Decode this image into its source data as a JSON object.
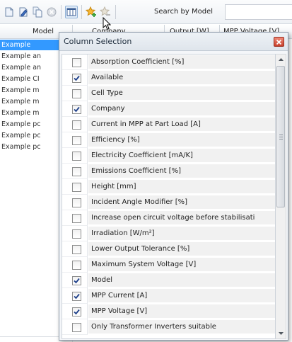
{
  "toolbar": {
    "search_label": "Search by Model",
    "search_value": "",
    "icons": [
      "new-icon",
      "edit-icon",
      "copy-icon",
      "delete-icon",
      "column-selection-icon",
      "add-favorite-icon",
      "remove-favorite-icon"
    ]
  },
  "table": {
    "columns": [
      "Model",
      "Company",
      "Output [W]",
      "MPP Voltage [V]"
    ],
    "rows": [
      "Example",
      "Example an",
      "Example an",
      "Example CI",
      "Example m",
      "Example m",
      "Example m",
      "Example pc",
      "Example pc",
      "Example pc"
    ]
  },
  "dialog": {
    "title": "Column Selection",
    "items": [
      {
        "label": "Absorption Coefficient [%]",
        "checked": false
      },
      {
        "label": "Available",
        "checked": true
      },
      {
        "label": "Cell Type",
        "checked": false
      },
      {
        "label": "Company",
        "checked": true
      },
      {
        "label": "Current in MPP at Part Load [A]",
        "checked": false
      },
      {
        "label": "Efficiency [%]",
        "checked": false
      },
      {
        "label": "Electricity Coefficient [mA/K]",
        "checked": false
      },
      {
        "label": "Emissions Coefficient [%]",
        "checked": false
      },
      {
        "label": "Height [mm]",
        "checked": false
      },
      {
        "label": "Incident Angle Modifier [%]",
        "checked": false
      },
      {
        "label": "Increase open circuit voltage before stabilisati",
        "checked": false
      },
      {
        "label": "Irradiation [W/m²]",
        "checked": false
      },
      {
        "label": "Lower Output Tolerance [%]",
        "checked": false
      },
      {
        "label": "Maximum System Voltage [V]",
        "checked": false
      },
      {
        "label": "Model",
        "checked": true
      },
      {
        "label": "MPP Current [A]",
        "checked": true
      },
      {
        "label": "MPP Voltage [V]",
        "checked": true
      },
      {
        "label": "Only Transformer Inverters suitable",
        "checked": false
      }
    ]
  },
  "colors": {
    "selection": "#3399ff",
    "close_button": "#c8412c",
    "checkmark": "#1d3f8a"
  }
}
